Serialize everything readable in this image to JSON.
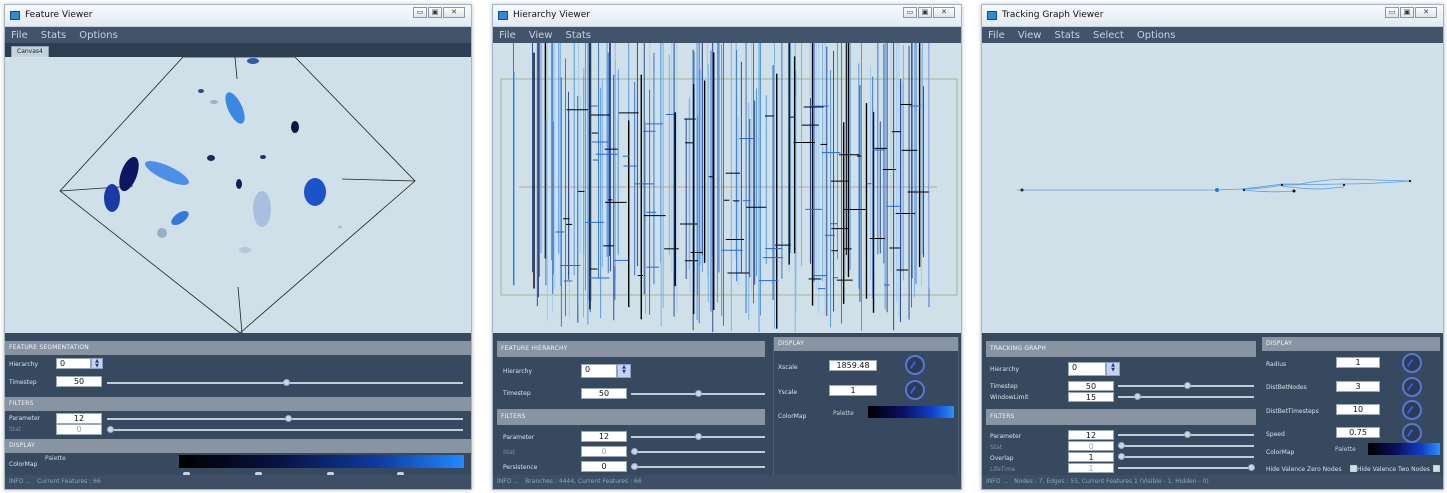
{
  "feature_viewer": {
    "title": "Feature Viewer",
    "menu": [
      "File",
      "Stats",
      "Options"
    ],
    "tab": "Canvas4",
    "seg_title": "FEATURE SEGMENTATION",
    "hierarchy_label": "Hierarchy",
    "hierarchy_value": "0",
    "timestep_label": "Timestep",
    "timestep_value": "50",
    "filters_title": "FILTERS",
    "parameter_label": "Parameter",
    "parameter_value": "12",
    "stat_label": "Stat",
    "stat_value": "0",
    "display_title": "DISPLAY",
    "colormap_label": "ColorMap",
    "palette_label": "Palette",
    "status_info": "INFO ...",
    "status_text": "Current Features : 66"
  },
  "hierarchy_viewer": {
    "title": "Hierarchy Viewer",
    "menu": [
      "File",
      "View",
      "Stats"
    ],
    "fh_title": "FEATURE HIERARCHY",
    "hierarchy_label": "Hierarchy",
    "hierarchy_value": "0",
    "timestep_label": "Timestep",
    "timestep_value": "50",
    "filters_title": "FILTERS",
    "parameter_label": "Parameter",
    "parameter_value": "12",
    "stat_label": "Stat",
    "stat_value": "0",
    "persistence_label": "Persistence",
    "persistence_value": "0",
    "display_title": "DISPLAY",
    "xscale_label": "Xscale",
    "xscale_value": "1859.48",
    "yscale_label": "Yscale",
    "yscale_value": "1",
    "colormap_label": "ColorMap",
    "palette_label": "Palette",
    "status_info": "INFO ...",
    "status_text": "Branches : 4444, Current Features : 66"
  },
  "tracking_viewer": {
    "title": "Tracking Graph Viewer",
    "menu": [
      "File",
      "View",
      "Stats",
      "Select",
      "Options"
    ],
    "tg_title": "TRACKING GRAPH",
    "hierarchy_label": "Hierarchy",
    "hierarchy_value": "0",
    "timestep_label": "Timestep",
    "timestep_value": "50",
    "window_label": "WindowLimit",
    "window_value": "15",
    "filters_title": "FILTERS",
    "parameter_label": "Parameter",
    "parameter_value": "12",
    "stat_label": "Stat",
    "stat_value": "0",
    "overlap_label": "Overlap",
    "overlap_value": "1",
    "lifetime_label": "LifeTime",
    "lifetime_value": "1",
    "display_title": "DISPLAY",
    "radius_label": "Radius",
    "radius_value": "1",
    "distnodes_label": "DistBetNodes",
    "distnodes_value": "3",
    "disttime_label": "DistBetTimesteps",
    "disttime_value": "10",
    "speed_label": "Speed",
    "speed_value": "0.75",
    "colormap_label": "ColorMap",
    "palette_label": "Palette",
    "hide_zero_label": "Hide Valence Zero Nodes",
    "hide_two_label": "Hide Valence Two Nodes",
    "status_info": "INFO ...",
    "status_text": "Nodes : 7, Edges : 55, Current Features 1 (Visible - 1, Hidden - 0)"
  },
  "colors": {
    "panel": "#36495e",
    "canvas": "#cfe0e8",
    "accent": "#1f7ae8"
  }
}
